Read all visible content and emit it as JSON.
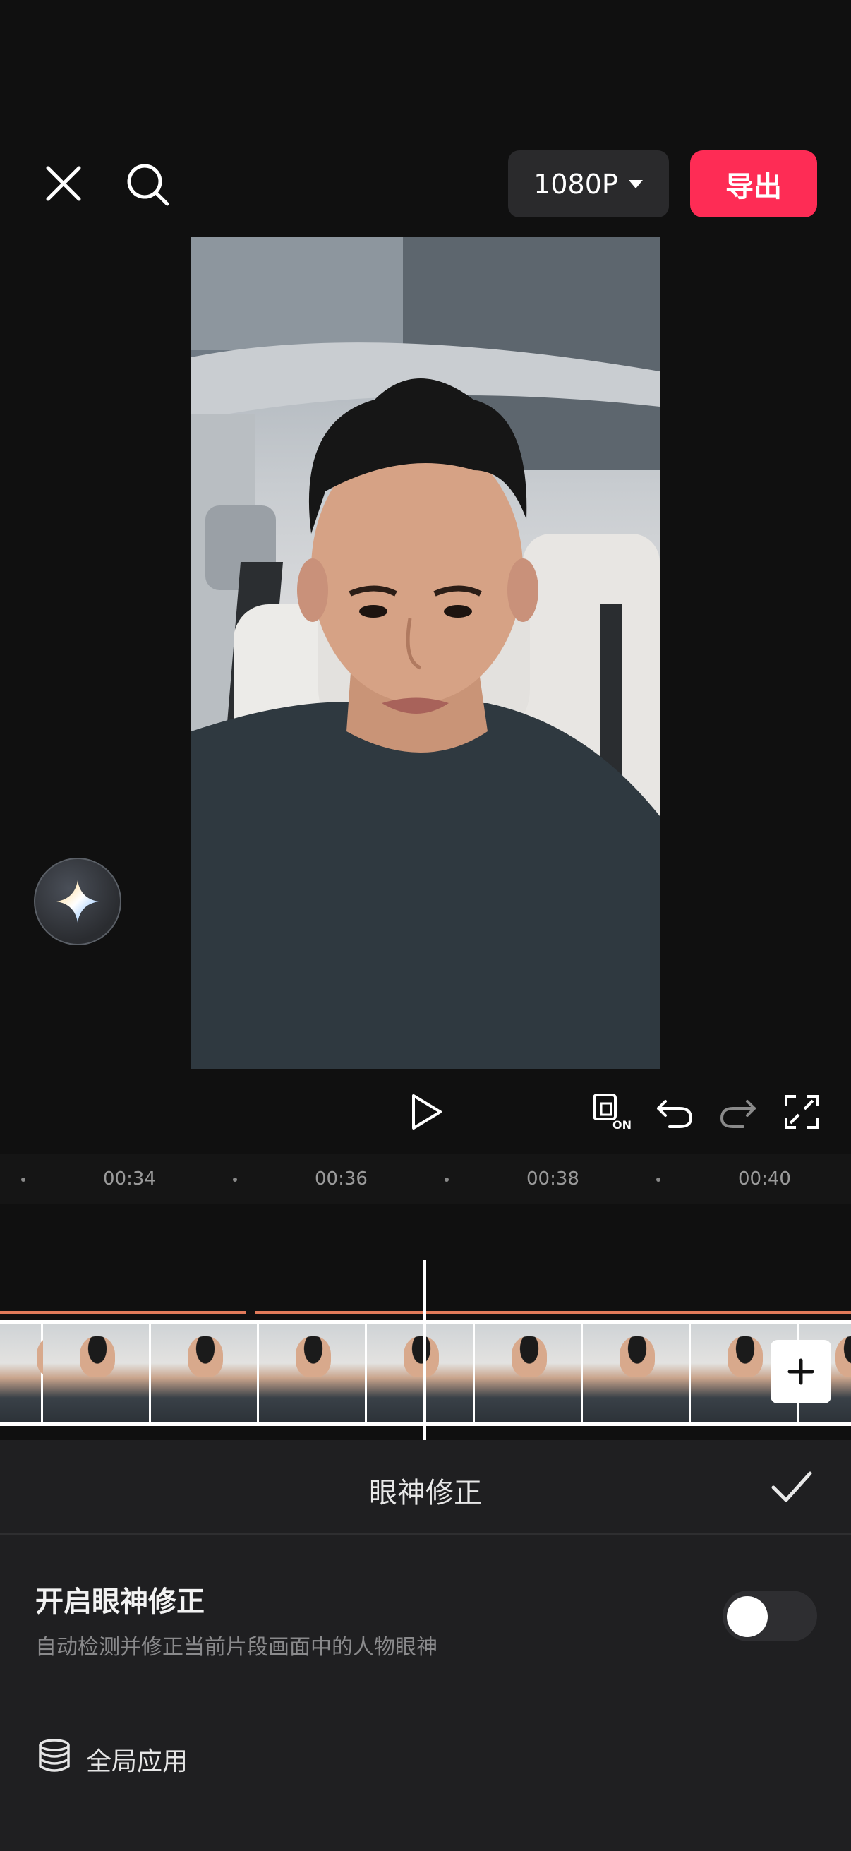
{
  "header": {
    "resolution_label": "1080P",
    "export_label": "导出"
  },
  "timeline": {
    "ticks": [
      "00:34",
      "00:36",
      "00:38",
      "00:40"
    ]
  },
  "panel": {
    "title": "眼神修正",
    "option_title": "开启眼神修正",
    "option_description": "自动检测并修正当前片段画面中的人物眼神",
    "toggle_on": false,
    "global_apply_label": "全局应用"
  },
  "colors": {
    "accent": "#fe2c55",
    "background": "#101010",
    "panel": "#1f1f21"
  }
}
